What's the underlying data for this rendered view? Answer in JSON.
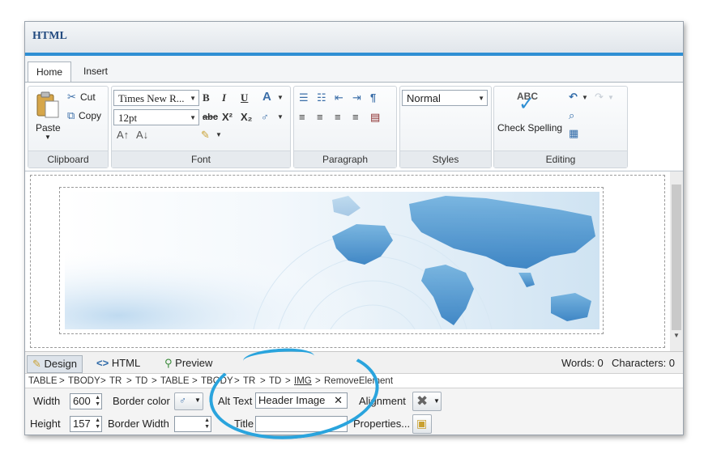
{
  "title": "HTML",
  "tabs": [
    "Home",
    "Insert"
  ],
  "ribbon": {
    "clipboard": {
      "paste": "Paste",
      "cut": "Cut",
      "copy": "Copy",
      "label": "Clipboard"
    },
    "font": {
      "font_name": "Times New R...",
      "font_size": "12pt",
      "label": "Font"
    },
    "paragraph": {
      "label": "Paragraph"
    },
    "styles": {
      "value": "Normal",
      "label": "Styles"
    },
    "editing": {
      "check_spelling": "Check Spelling",
      "abc": "ABC",
      "label": "Editing"
    }
  },
  "modes": {
    "design": "Design",
    "html": "HTML",
    "preview": "Preview"
  },
  "counts": {
    "words": "Words: 0",
    "characters": "Characters: 0"
  },
  "path": [
    "TABLE",
    "TBODY",
    "TR",
    "TD",
    "TABLE",
    "TBODY",
    "TR",
    "TD",
    "IMG",
    "RemoveElement"
  ],
  "props": {
    "width_label": "Width",
    "width_value": "600",
    "height_label": "Height",
    "height_value": "157",
    "border_color_label": "Border color",
    "border_width_label": "Border Width",
    "alt_text_label": "Alt Text",
    "alt_text_value": "Header Image",
    "title_label": "Title",
    "alignment_label": "Alignment",
    "properties_label": "Properties..."
  },
  "colors": {
    "accent": "#2f8fd4",
    "highlight": "#2aa4dd",
    "title": "#234b80"
  }
}
